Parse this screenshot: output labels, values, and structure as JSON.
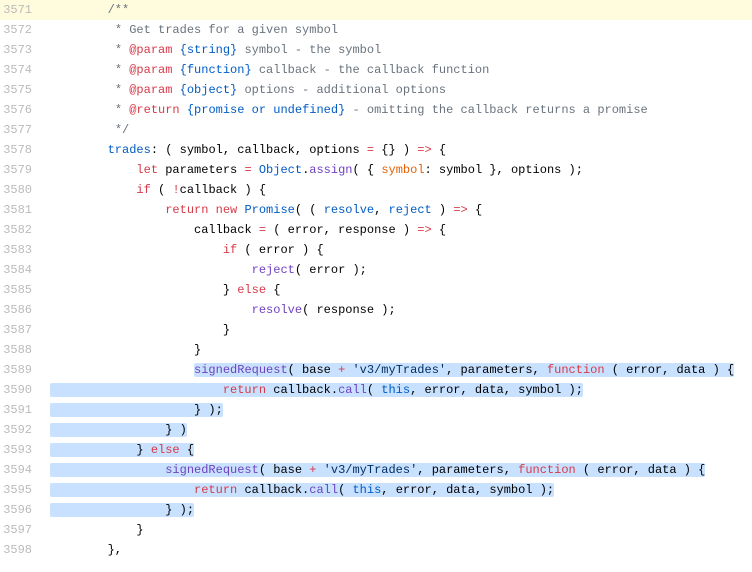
{
  "lines": [
    {
      "num": 3571,
      "highlighted": true,
      "segments": [
        {
          "indent": "        ",
          "cls": "cm",
          "text": "/**"
        }
      ]
    },
    {
      "num": 3572,
      "segments": [
        {
          "indent": "         ",
          "cls": "cm",
          "text": "* Get trades for a given symbol"
        }
      ]
    },
    {
      "num": 3573,
      "segments": [
        {
          "indent": "         ",
          "cls": "cm",
          "text": "* "
        },
        {
          "cls": "jsdoc-tag",
          "text": "@param"
        },
        {
          "cls": "cm",
          "text": " "
        },
        {
          "cls": "jsdoc-type",
          "text": "{string}"
        },
        {
          "cls": "cm",
          "text": " symbol - the symbol"
        }
      ]
    },
    {
      "num": 3574,
      "segments": [
        {
          "indent": "         ",
          "cls": "cm",
          "text": "* "
        },
        {
          "cls": "jsdoc-tag",
          "text": "@param"
        },
        {
          "cls": "cm",
          "text": " "
        },
        {
          "cls": "jsdoc-type",
          "text": "{function}"
        },
        {
          "cls": "cm",
          "text": " callback - the callback function"
        }
      ]
    },
    {
      "num": 3575,
      "segments": [
        {
          "indent": "         ",
          "cls": "cm",
          "text": "* "
        },
        {
          "cls": "jsdoc-tag",
          "text": "@param"
        },
        {
          "cls": "cm",
          "text": " "
        },
        {
          "cls": "jsdoc-type",
          "text": "{object}"
        },
        {
          "cls": "cm",
          "text": " options - additional options"
        }
      ]
    },
    {
      "num": 3576,
      "segments": [
        {
          "indent": "         ",
          "cls": "cm",
          "text": "* "
        },
        {
          "cls": "jsdoc-tag",
          "text": "@return"
        },
        {
          "cls": "cm",
          "text": " "
        },
        {
          "cls": "jsdoc-type",
          "text": "{promise or undefined}"
        },
        {
          "cls": "cm",
          "text": " - omitting the callback returns a promise"
        }
      ]
    },
    {
      "num": 3577,
      "segments": [
        {
          "indent": "         ",
          "cls": "cm",
          "text": "*/"
        }
      ]
    },
    {
      "num": 3578,
      "segments": [
        {
          "indent": "        ",
          "cls": "kd",
          "text": "trades"
        },
        {
          "text": ": ( symbol, callback, options "
        },
        {
          "cls": "k",
          "text": "="
        },
        {
          "text": " {} ) "
        },
        {
          "cls": "k",
          "text": "=>"
        },
        {
          "text": " {"
        }
      ]
    },
    {
      "num": 3579,
      "segments": [
        {
          "indent": "            ",
          "cls": "k",
          "text": "let"
        },
        {
          "text": " parameters "
        },
        {
          "cls": "k",
          "text": "="
        },
        {
          "text": " "
        },
        {
          "cls": "nb",
          "text": "Object"
        },
        {
          "text": "."
        },
        {
          "cls": "nf",
          "text": "assign"
        },
        {
          "text": "( { "
        },
        {
          "cls": "na",
          "text": "symbol"
        },
        {
          "text": ": symbol }, options );"
        }
      ]
    },
    {
      "num": 3580,
      "segments": [
        {
          "indent": "            ",
          "cls": "k",
          "text": "if"
        },
        {
          "text": " ( "
        },
        {
          "cls": "k",
          "text": "!"
        },
        {
          "text": "callback ) {"
        }
      ]
    },
    {
      "num": 3581,
      "segments": [
        {
          "indent": "                ",
          "cls": "k",
          "text": "return"
        },
        {
          "text": " "
        },
        {
          "cls": "k",
          "text": "new"
        },
        {
          "text": " "
        },
        {
          "cls": "nb",
          "text": "Promise"
        },
        {
          "text": "( ( "
        },
        {
          "cls": "nb",
          "text": "resolve"
        },
        {
          "text": ", "
        },
        {
          "cls": "nb",
          "text": "reject"
        },
        {
          "text": " ) "
        },
        {
          "cls": "k",
          "text": "=>"
        },
        {
          "text": " {"
        }
      ]
    },
    {
      "num": 3582,
      "segments": [
        {
          "indent": "                    ",
          "text": "callback "
        },
        {
          "cls": "k",
          "text": "="
        },
        {
          "text": " ( error, response ) "
        },
        {
          "cls": "k",
          "text": "=>"
        },
        {
          "text": " {"
        }
      ]
    },
    {
      "num": 3583,
      "segments": [
        {
          "indent": "                        ",
          "cls": "k",
          "text": "if"
        },
        {
          "text": " ( error ) {"
        }
      ]
    },
    {
      "num": 3584,
      "segments": [
        {
          "indent": "                            ",
          "cls": "nf",
          "text": "reject"
        },
        {
          "text": "( error );"
        }
      ]
    },
    {
      "num": 3585,
      "segments": [
        {
          "indent": "                        ",
          "text": "} "
        },
        {
          "cls": "k",
          "text": "else"
        },
        {
          "text": " {"
        }
      ]
    },
    {
      "num": 3586,
      "segments": [
        {
          "indent": "                            ",
          "cls": "nf",
          "text": "resolve"
        },
        {
          "text": "( response );"
        }
      ]
    },
    {
      "num": 3587,
      "segments": [
        {
          "indent": "                        ",
          "text": "}"
        }
      ]
    },
    {
      "num": 3588,
      "segments": [
        {
          "indent": "                    ",
          "text": "}"
        }
      ]
    },
    {
      "num": 3589,
      "segments": [
        {
          "indent": "                    ",
          "sel": true,
          "parts": [
            {
              "cls": "nf",
              "text": "signedRequest"
            },
            {
              "text": "( base "
            },
            {
              "cls": "k",
              "text": "+"
            },
            {
              "text": " "
            },
            {
              "cls": "s",
              "text": "'v3/myTrades'"
            },
            {
              "text": ", parameters, "
            },
            {
              "cls": "k",
              "text": "function"
            },
            {
              "text": " ( error, data ) {"
            }
          ]
        }
      ]
    },
    {
      "num": 3590,
      "segments": [
        {
          "indent": "",
          "sel": true,
          "parts": [
            {
              "text": "                        "
            },
            {
              "cls": "k",
              "text": "return"
            },
            {
              "text": " callback."
            },
            {
              "cls": "nf",
              "text": "call"
            },
            {
              "text": "( "
            },
            {
              "cls": "kd",
              "text": "this"
            },
            {
              "text": ", error, data, symbol );"
            }
          ]
        }
      ]
    },
    {
      "num": 3591,
      "segments": [
        {
          "indent": "",
          "sel": true,
          "parts": [
            {
              "text": "                    } );"
            }
          ]
        }
      ]
    },
    {
      "num": 3592,
      "segments": [
        {
          "indent": "",
          "sel": true,
          "parts": [
            {
              "text": "                } )"
            }
          ]
        }
      ]
    },
    {
      "num": 3593,
      "segments": [
        {
          "indent": "",
          "sel": true,
          "parts": [
            {
              "text": "            } "
            },
            {
              "cls": "k",
              "text": "else"
            },
            {
              "text": " {"
            }
          ]
        }
      ]
    },
    {
      "num": 3594,
      "segments": [
        {
          "indent": "",
          "sel": true,
          "parts": [
            {
              "text": "                "
            },
            {
              "cls": "nf",
              "text": "signedRequest"
            },
            {
              "text": "( base "
            },
            {
              "cls": "k",
              "text": "+"
            },
            {
              "text": " "
            },
            {
              "cls": "s",
              "text": "'v3/myTrades'"
            },
            {
              "text": ", parameters, "
            },
            {
              "cls": "k",
              "text": "function"
            },
            {
              "text": " ( error, data ) {"
            }
          ]
        }
      ]
    },
    {
      "num": 3595,
      "segments": [
        {
          "indent": "",
          "sel": true,
          "parts": [
            {
              "text": "                    "
            },
            {
              "cls": "k",
              "text": "return"
            },
            {
              "text": " callback."
            },
            {
              "cls": "nf",
              "text": "call"
            },
            {
              "text": "( "
            },
            {
              "cls": "kd",
              "text": "this"
            },
            {
              "text": ", error, data, symbol );"
            }
          ]
        }
      ]
    },
    {
      "num": 3596,
      "segments": [
        {
          "indent": "",
          "sel": true,
          "parts": [
            {
              "text": "                } );"
            }
          ]
        }
      ]
    },
    {
      "num": 3597,
      "segments": [
        {
          "indent": "            ",
          "text": "}"
        }
      ]
    },
    {
      "num": 3598,
      "segments": [
        {
          "indent": "        ",
          "text": "},"
        }
      ]
    }
  ]
}
